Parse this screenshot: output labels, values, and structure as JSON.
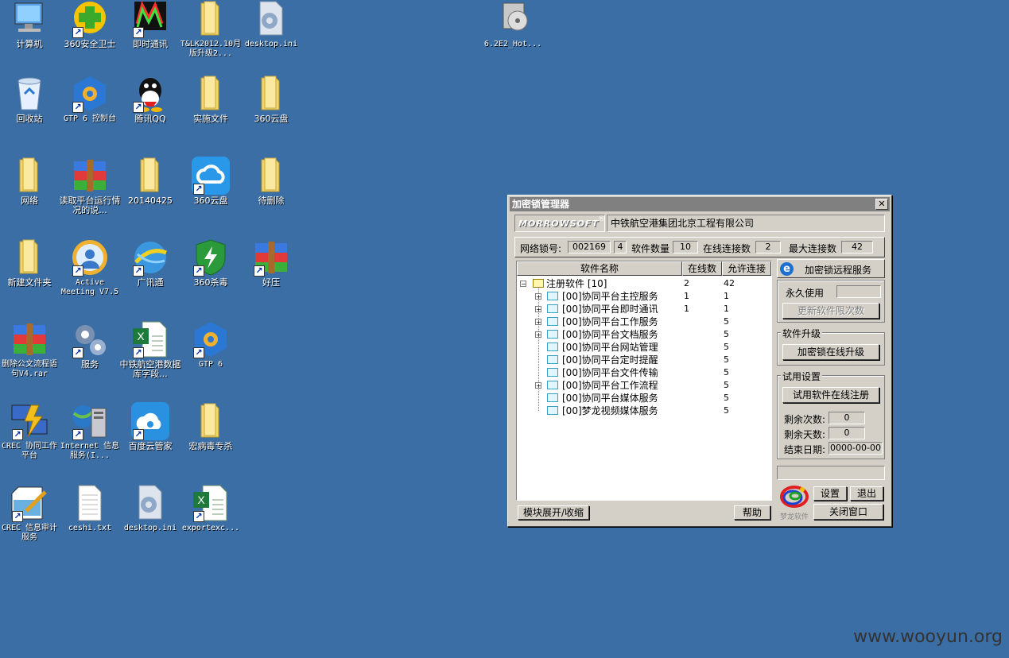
{
  "desktop": {
    "icons": [
      {
        "label": "计算机"
      },
      {
        "label": "360安全卫士"
      },
      {
        "label": "即时通讯"
      },
      {
        "label": "T&LK2012.10月版升级2..."
      },
      {
        "label": "desktop.ini"
      },
      {
        "label": "6.2E2_Hot..."
      },
      {
        "label": "回收站"
      },
      {
        "label": "GTP 6 控制台"
      },
      {
        "label": "腾讯QQ"
      },
      {
        "label": "实施文件"
      },
      {
        "label": "360云盘"
      },
      {
        "label": "网络"
      },
      {
        "label": "读取平台运行情况的说..."
      },
      {
        "label": "20140425"
      },
      {
        "label": "360云盘"
      },
      {
        "label": "待删除"
      },
      {
        "label": "新建文件夹"
      },
      {
        "label": "Active Meeting V7.5"
      },
      {
        "label": "广讯通"
      },
      {
        "label": "360杀毒"
      },
      {
        "label": "好压"
      },
      {
        "label": "删除公文流程语句V4.rar"
      },
      {
        "label": "服务"
      },
      {
        "label": "中铁航空港数据库字段..."
      },
      {
        "label": "GTP 6"
      },
      {
        "label": "CREC 协同工作平台"
      },
      {
        "label": "Internet 信息服务(I..."
      },
      {
        "label": "百度云管家"
      },
      {
        "label": "宏病毒专杀"
      },
      {
        "label": "CREC 信息审计服务"
      },
      {
        "label": "ceshi.txt"
      },
      {
        "label": "desktop.ini"
      },
      {
        "label": "exportexc..."
      }
    ]
  },
  "dialog": {
    "title": "加密锁管理器",
    "close": "✕",
    "logo_text": "MORROWSOFT",
    "logo_mark": "®",
    "company": "中铁航空港集团北京工程有限公司",
    "net_lock_label": "网络锁号:",
    "net_lock_value": "002169",
    "net_lock_sub": "4",
    "software_count_label": "软件数量",
    "software_count_value": "10",
    "online_conn_label": "在线连接数",
    "online_conn_value": "2",
    "max_conn_label": "最大连接数",
    "max_conn_value": "42",
    "table": {
      "headers": [
        "软件名称",
        "在线数",
        "允许连接"
      ],
      "root": {
        "name": "注册软件 [10]",
        "online": "2",
        "allowed": "42"
      },
      "rows": [
        {
          "name": "[00]协同平台主控服务",
          "online": "1",
          "allowed": "1",
          "expandable": true
        },
        {
          "name": "[00]协同平台即时通讯",
          "online": "1",
          "allowed": "1",
          "expandable": true
        },
        {
          "name": "[00]协同平台工作服务",
          "online": "",
          "allowed": "5",
          "expandable": true
        },
        {
          "name": "[00]协同平台文档服务",
          "online": "",
          "allowed": "5",
          "expandable": true
        },
        {
          "name": "[00]协同平台网站管理",
          "online": "",
          "allowed": "5",
          "expandable": false
        },
        {
          "name": "[00]协同平台定时提醒",
          "online": "",
          "allowed": "5",
          "expandable": false
        },
        {
          "name": "[00]协同平台文件传输",
          "online": "",
          "allowed": "5",
          "expandable": false
        },
        {
          "name": "[00]协同平台工作流程",
          "online": "",
          "allowed": "5",
          "expandable": true
        },
        {
          "name": "[00]协同平台媒体服务",
          "online": "",
          "allowed": "5",
          "expandable": false
        },
        {
          "name": "[00]梦龙视频媒体服务",
          "online": "",
          "allowed": "5",
          "expandable": false
        }
      ]
    },
    "remote_service": "加密锁远程服务",
    "permanent_label": "永久使用",
    "update_limit_btn": "更新软件限次数",
    "upgrade_group": "软件升级",
    "online_upgrade_btn": "加密锁在线升级",
    "trial_group": "试用设置",
    "trial_register_btn": "试用软件在线注册",
    "remaining_times_label": "剩余次数:",
    "remaining_times_value": "0",
    "remaining_days_label": "剩余天数:",
    "remaining_days_value": "0",
    "end_date_label": "结束日期:",
    "end_date_value": "0000-00-00",
    "expand_btn": "模块展开/收缩",
    "help_btn": "帮助",
    "settings_btn": "设置",
    "exit_btn": "退出",
    "close_window_btn": "关闭窗口",
    "bottom_logo": "梦龙软件"
  },
  "watermark": "www.wooyun.org"
}
